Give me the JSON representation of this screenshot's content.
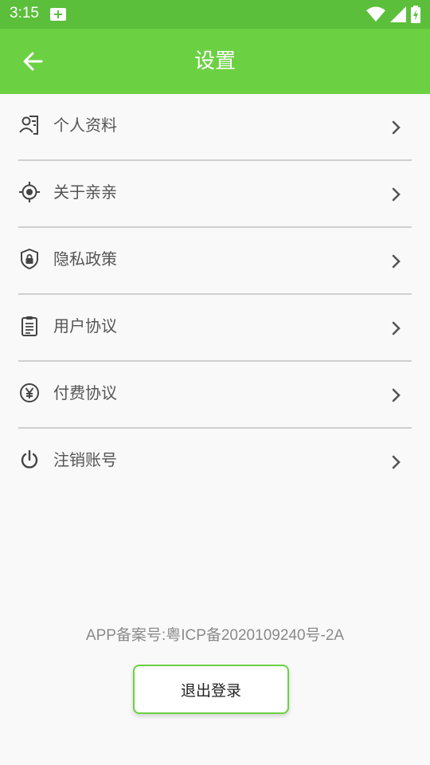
{
  "status_bar": {
    "time": "3:15",
    "icons": [
      "notification-plus-icon",
      "wifi-icon",
      "cell-signal-icon",
      "battery-charging-icon"
    ]
  },
  "app_bar": {
    "back_icon": "arrow-left-icon",
    "title": "设置"
  },
  "settings": {
    "items": [
      {
        "label": "个人资料",
        "icon": "profile-card-icon"
      },
      {
        "label": "关于亲亲",
        "icon": "target-icon"
      },
      {
        "label": "隐私政策",
        "icon": "shield-lock-icon"
      },
      {
        "label": "用户协议",
        "icon": "clipboard-icon"
      },
      {
        "label": "付费协议",
        "icon": "yen-icon"
      },
      {
        "label": "注销账号",
        "icon": "power-icon"
      }
    ]
  },
  "footer": {
    "icp": "APP备案号:粤ICP备2020109240号-2A",
    "logout_label": "退出登录"
  },
  "colors": {
    "status_bar": "#5bbf3b",
    "app_bar": "#6cd043",
    "background": "#f9f9f9",
    "divider": "#d0d0d0",
    "button_border": "#6cd043"
  }
}
